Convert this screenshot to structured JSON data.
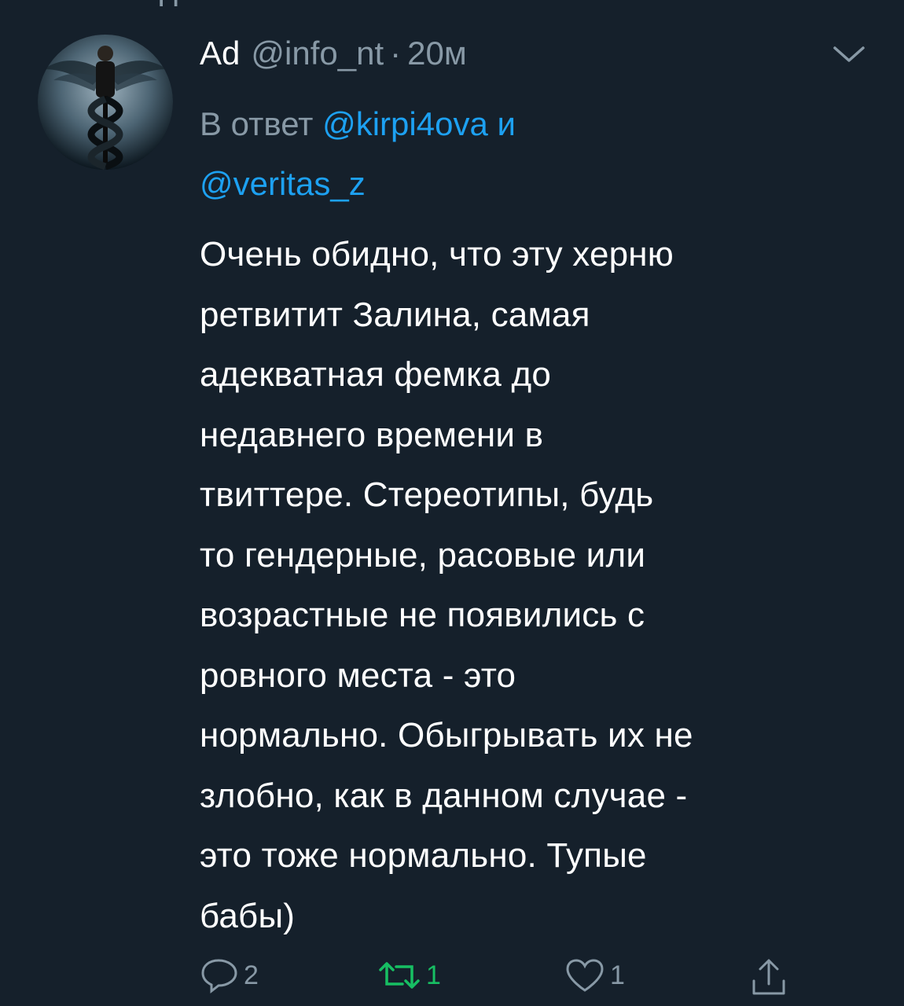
{
  "top_fragment": "Ц. — — — — — — — —",
  "tweet": {
    "author_name": "Ad",
    "handle": "@info_nt",
    "separator": "·",
    "time": "20м",
    "reply_prefix": "В ответ",
    "mention_1": "@kirpi4ova",
    "reply_and": "и",
    "mention_2": "@veritas_z",
    "text": "Очень обидно, что эту херню\nретвитит Залина, самая\nадекватная фемка до\nнедавнего времени в\nтвиттере. Стереотипы, будь\nто  гендерные, расовые или\nвозрастные не появились с\nровного места - это\nнормально. Обыгрывать их не\nзлобно, как в данном случае -\nэто тоже нормально. Тупые\nбабы)"
  },
  "actions": {
    "reply_count": "2",
    "retweet_count": "1",
    "like_count": "1"
  },
  "colors": {
    "background": "#15202b",
    "secondary_text": "#8899a6",
    "link": "#1da1f2",
    "retweet_active": "#17bf63"
  },
  "icons": {
    "reply": "speech-bubble-icon",
    "retweet": "retweet-icon",
    "like": "heart-icon",
    "share": "share-icon",
    "menu": "chevron-down-icon"
  }
}
